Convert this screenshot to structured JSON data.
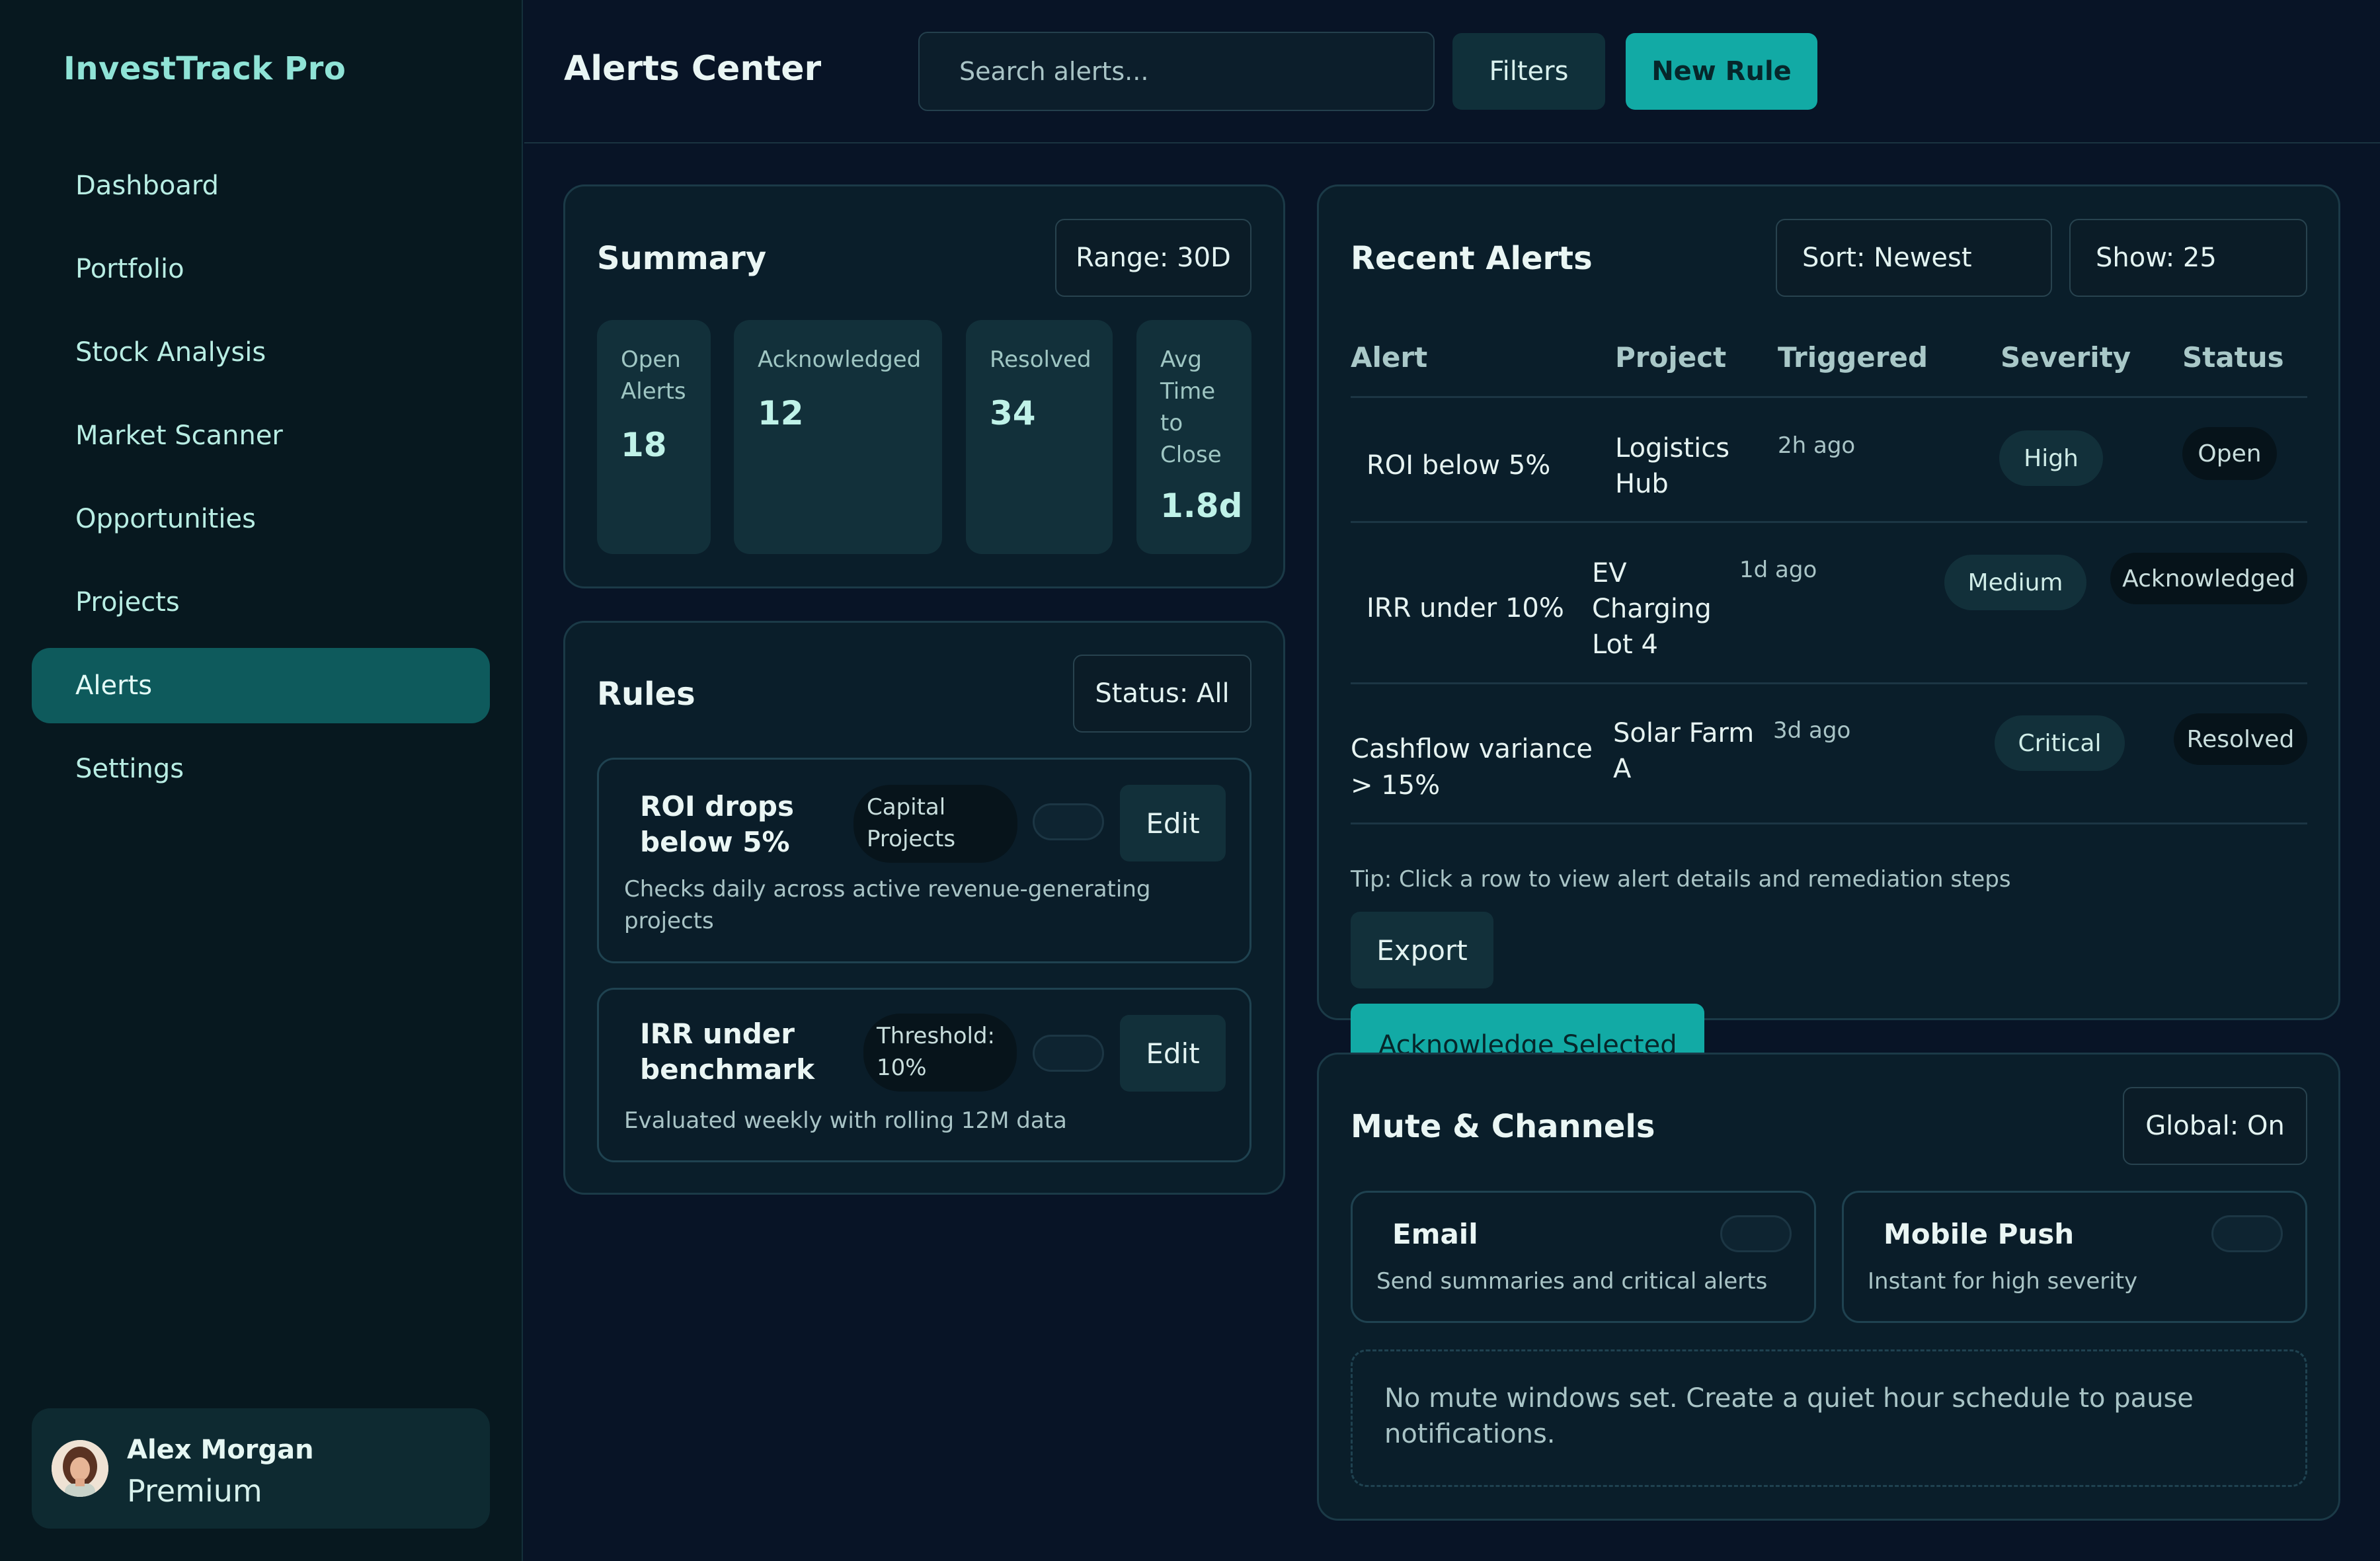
{
  "app": {
    "brand": "InvestTrack Pro"
  },
  "sidebar": {
    "items": [
      {
        "label": "Dashboard",
        "active": false
      },
      {
        "label": "Portfolio",
        "active": false
      },
      {
        "label": "Stock Analysis",
        "active": false
      },
      {
        "label": "Market Scanner",
        "active": false
      },
      {
        "label": "Opportunities",
        "active": false
      },
      {
        "label": "Projects",
        "active": false
      },
      {
        "label": "Alerts",
        "active": true
      },
      {
        "label": "Settings",
        "active": false
      }
    ],
    "user": {
      "name": "Alex Morgan",
      "plan": "Premium"
    }
  },
  "header": {
    "title": "Alerts Center",
    "search_placeholder": "Search alerts...",
    "filters_label": "Filters",
    "new_rule_label": "New Rule"
  },
  "summary": {
    "title": "Summary",
    "range_label": "Range: 30D",
    "stats": [
      {
        "label_lines": [
          "Open",
          "Alerts"
        ],
        "value": "18"
      },
      {
        "label_lines": [
          "Acknowledged"
        ],
        "value": "12"
      },
      {
        "label_lines": [
          "Resolved"
        ],
        "value": "34"
      },
      {
        "label_lines": [
          "Avg",
          "Time",
          "to",
          "Close"
        ],
        "value": "1.8d"
      }
    ]
  },
  "rules": {
    "title": "Rules",
    "status_label": "Status: All",
    "edit_label": "Edit",
    "items": [
      {
        "title_lines": [
          "ROI drops",
          "below 5%"
        ],
        "tag_lines": [
          "Capital",
          "Projects"
        ],
        "desc_lines": [
          "Checks daily across active revenue-generating",
          "projects"
        ]
      },
      {
        "title_lines": [
          "IRR under",
          "benchmark"
        ],
        "tag_lines": [
          "Threshold:",
          "10%"
        ],
        "desc_lines": [
          "Evaluated weekly with rolling 12M data"
        ]
      }
    ]
  },
  "recent_alerts": {
    "title": "Recent Alerts",
    "sort_label": "Sort: Newest",
    "show_label": "Show: 25",
    "columns": [
      "Alert",
      "Project",
      "Triggered",
      "Severity",
      "Status"
    ],
    "rows": [
      {
        "alert_lines": [
          "ROI below 5%"
        ],
        "project_lines": [
          "Logistics",
          "Hub"
        ],
        "triggered": "2h ago",
        "severity": "High",
        "status": "Open"
      },
      {
        "alert_lines": [
          "IRR under 10%"
        ],
        "project_lines": [
          "EV",
          "Charging",
          "Lot 4"
        ],
        "triggered": "1d ago",
        "severity": "Medium",
        "status": "Acknowledged"
      },
      {
        "alert_lines": [
          "Cashflow variance",
          "> 15%"
        ],
        "project_lines": [
          "Solar Farm",
          "A"
        ],
        "triggered": "3d ago",
        "severity": "Critical",
        "status": "Resolved"
      }
    ],
    "tip": "Tip: Click a row to view alert details and remediation steps",
    "export_label": "Export",
    "acknowledge_label": "Acknowledge Selected"
  },
  "mute": {
    "title": "Mute & Channels",
    "global_label": "Global: On",
    "channels": [
      {
        "title": "Email",
        "desc": "Send summaries and critical alerts"
      },
      {
        "title": "Mobile Push",
        "desc": "Instant for high severity"
      }
    ],
    "empty_lines": [
      "No mute windows set. Create a quiet hour schedule to pause",
      "notifications."
    ]
  }
}
